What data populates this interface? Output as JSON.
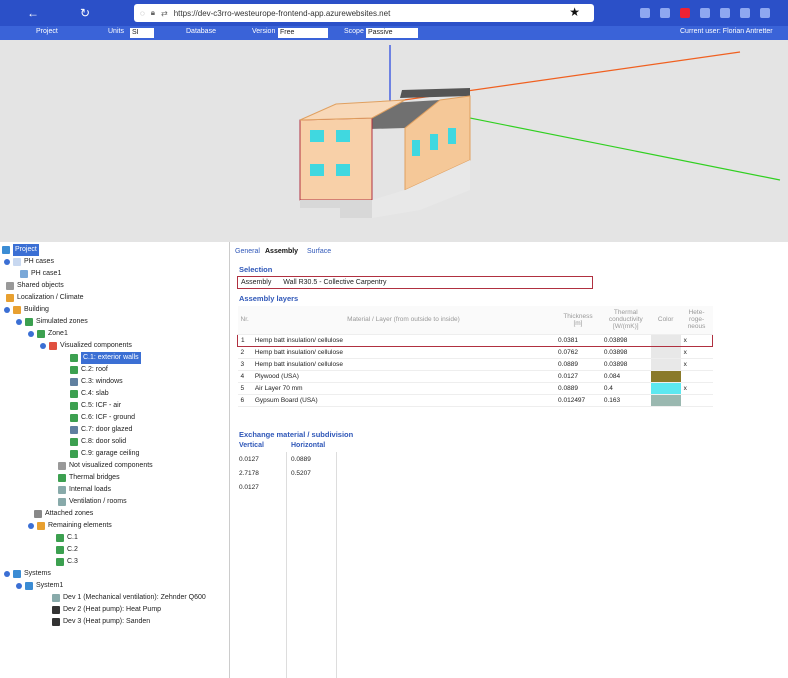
{
  "browser": {
    "url": "https://dev-c3rro-westeurope-frontend-app.azurewebsites.net"
  },
  "toolbar": {
    "project": "Project",
    "units_label": "Units",
    "units_value": "SI",
    "database": "Database",
    "version_label": "Version",
    "version_value": "Free",
    "scope_label": "Scope",
    "scope_value": "Passive",
    "right_text": "Current user: Florian Antretter"
  },
  "tree": {
    "project": "Project",
    "ph_cases": "PH cases",
    "ph_case1": "PH case1",
    "shared_objects": "Shared objects",
    "localization": "Localization / Climate",
    "building": "Building",
    "simulated_zones": "Simulated zones",
    "zone1": "Zone1",
    "visualized_components": "Visualized components",
    "c1": "C.1: exterior walls",
    "c2": "C.2: roof",
    "c3": "C.3: windows",
    "c4": "C.4: slab",
    "c5": "C.5: ICF - air",
    "c6": "C.6: ICF - ground",
    "c7": "C.7: door glazed",
    "c8": "C.8: door solid",
    "c9": "C.9: garage ceiling",
    "not_visualized": "Not visualized components",
    "thermal_bridges": "Thermal bridges",
    "internal_loads": "Internal loads",
    "ventilation": "Ventilation / rooms",
    "attached_zones": "Attached zones",
    "remaining": "Remaining elements",
    "r1": "C.1",
    "r2": "C.2",
    "r3": "C.3",
    "systems": "Systems",
    "system1": "System1",
    "dev1": "Dev 1 (Mechanical ventilation): Zehnder Q600",
    "dev2": "Dev 2 (Heat pump): Heat Pump",
    "dev3": "Dev 3 (Heat pump): Sanden"
  },
  "panel": {
    "tab_general": "General",
    "tab_assembly": "Assembly",
    "tab_surface": "Surface",
    "selection_title": "Selection",
    "assembly_label": "Assembly",
    "assembly_value": "Wall R30.5 - Collective Carpentry",
    "layers_title": "Assembly layers",
    "col_nr": "Nr.",
    "col_material": "Material / Layer (from outside to inside)",
    "col_thickness": "Thickness [m]",
    "col_conductivity": "Thermal conductivity [W/(mK)]",
    "col_color": "Color",
    "col_hetero": "Hete-roge-neous",
    "layers": [
      {
        "nr": "1",
        "material": "Hemp batt insulation/ cellulose",
        "thickness": "0.0381",
        "conductivity": "0.03898",
        "color": "#e8e8e8",
        "hetero": "x"
      },
      {
        "nr": "2",
        "material": "Hemp batt insulation/ cellulose",
        "thickness": "0.0762",
        "conductivity": "0.03898",
        "color": "#e8e8e8",
        "hetero": "x"
      },
      {
        "nr": "3",
        "material": "Hemp batt insulation/ cellulose",
        "thickness": "0.0889",
        "conductivity": "0.03898",
        "color": "#e8e8e8",
        "hetero": "x"
      },
      {
        "nr": "4",
        "material": "Plywood (USA)",
        "thickness": "0.0127",
        "conductivity": "0.084",
        "color": "#8a7a2a",
        "hetero": ""
      },
      {
        "nr": "5",
        "material": "Air Layer 70 mm",
        "thickness": "0.0889",
        "conductivity": "0.4",
        "color": "#5ce8f0",
        "hetero": "x"
      },
      {
        "nr": "6",
        "material": "Gypsum Board (USA)",
        "thickness": "0.012497",
        "conductivity": "0.163",
        "color": "#9ab8b0",
        "hetero": ""
      }
    ],
    "exchange_title": "Exchange material / subdivision",
    "vertical": "Vertical",
    "horizontal": "Horizontal",
    "v1": "0.0127",
    "v2": "2.7178",
    "v3": "0.0127",
    "h1": "0.0889",
    "h2": "0.5207"
  }
}
